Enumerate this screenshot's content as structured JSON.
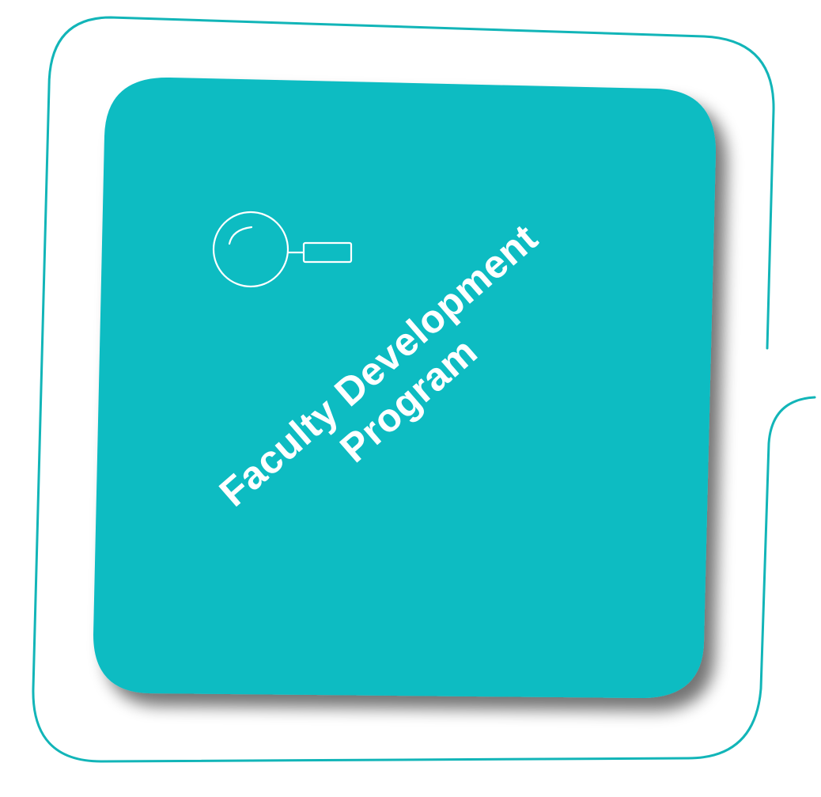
{
  "card": {
    "title_line1": "Faculty Development",
    "title_line2": "Program",
    "icon": "magnifier-icon",
    "background_color": "#0abcc2",
    "frame_color": "#12b5b8",
    "text_color": "#ffffff"
  }
}
